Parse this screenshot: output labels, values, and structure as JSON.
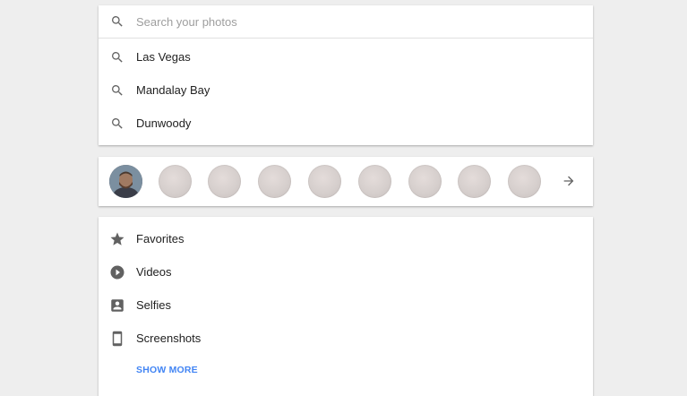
{
  "search": {
    "placeholder": "Search your photos",
    "value": "",
    "icon": "search-icon"
  },
  "suggestions": [
    {
      "label": "Las Vegas",
      "icon": "search-icon"
    },
    {
      "label": "Mandalay Bay",
      "icon": "search-icon"
    },
    {
      "label": "Dunwoody",
      "icon": "search-icon"
    }
  ],
  "people": {
    "faces": [
      "face-1",
      "face-2",
      "face-3",
      "face-4",
      "face-5",
      "face-6",
      "face-7",
      "face-8",
      "face-9"
    ],
    "more_icon": "arrow-right-icon"
  },
  "things": {
    "items": [
      {
        "label": "Favorites",
        "icon": "star-icon"
      },
      {
        "label": "Videos",
        "icon": "play-circle-icon"
      },
      {
        "label": "Selfies",
        "icon": "portrait-icon"
      },
      {
        "label": "Screenshots",
        "icon": "phone-icon"
      }
    ],
    "show_more_label": "SHOW MORE"
  },
  "colors": {
    "background": "#eeeeee",
    "card": "#ffffff",
    "accent": "#4285f4",
    "icon": "#616161",
    "placeholder": "#9e9e9e"
  }
}
